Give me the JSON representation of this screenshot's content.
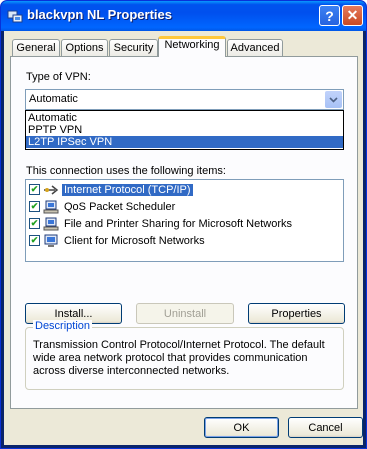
{
  "window": {
    "title": "blackvpn NL Properties",
    "help_glyph": "?",
    "close_glyph": "✕"
  },
  "tabs": [
    {
      "label": "General"
    },
    {
      "label": "Options"
    },
    {
      "label": "Security"
    },
    {
      "label": "Networking",
      "active": true
    },
    {
      "label": "Advanced"
    }
  ],
  "vpn": {
    "label": "Type of VPN:",
    "selected": "Automatic",
    "options": [
      "Automatic",
      "PPTP VPN",
      "L2TP IPSec VPN"
    ],
    "highlighted_option": "L2TP IPSec VPN"
  },
  "items": {
    "label": "This connection uses the following items:",
    "list": [
      {
        "label": "Internet Protocol (TCP/IP)",
        "checked": true,
        "selected": true,
        "icon": "network-protocol-icon"
      },
      {
        "label": "QoS Packet Scheduler",
        "checked": true,
        "selected": false,
        "icon": "network-service-icon"
      },
      {
        "label": "File and Printer Sharing for Microsoft Networks",
        "checked": true,
        "selected": false,
        "icon": "network-service-icon"
      },
      {
        "label": "Client for Microsoft Networks",
        "checked": true,
        "selected": false,
        "icon": "network-client-icon"
      }
    ]
  },
  "buttons": {
    "install": "Install...",
    "uninstall": "Uninstall",
    "properties": "Properties",
    "ok": "OK",
    "cancel": "Cancel"
  },
  "description": {
    "title": "Description",
    "text": "Transmission Control Protocol/Internet Protocol. The default wide area network protocol that provides communication across diverse interconnected networks."
  },
  "colors": {
    "titlebar": "#0055ea",
    "selection": "#316ac5",
    "group_title": "#0046d5"
  }
}
